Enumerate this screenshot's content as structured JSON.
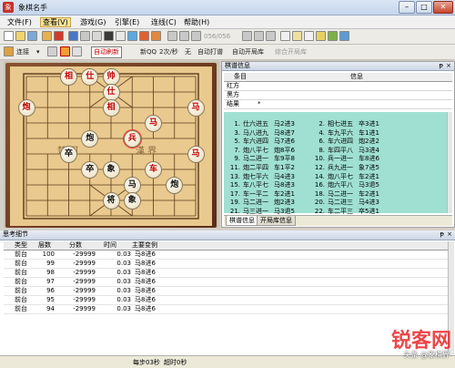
{
  "window": {
    "title": "象棋名手",
    "min": "–",
    "max": "□",
    "close": "✕"
  },
  "menu": [
    "文件(F)",
    "查看(V)",
    "游戏(G)",
    "引擎(E)",
    "连线(C)",
    "帮助(H)"
  ],
  "toolbar1": {
    "move_counter": "056/056"
  },
  "toolbar2": {
    "connect_label": "连接",
    "auto_refresh": "自动刷新",
    "new_qq": "新QQ",
    "rate": "2次/秒",
    "none": "无",
    "auto_play": "自动打谱",
    "auto_open": "自动开局库",
    "open_book": "综合开局库"
  },
  "board": {
    "pieces": [
      {
        "t": "相",
        "c": "red",
        "f": 3,
        "r": 1
      },
      {
        "t": "仕",
        "c": "red",
        "f": 4,
        "r": 1
      },
      {
        "t": "帅",
        "c": "red",
        "f": 5,
        "r": 1
      },
      {
        "t": "仕",
        "c": "red",
        "f": 5,
        "r": 2
      },
      {
        "t": "炮",
        "c": "red",
        "f": 1,
        "r": 3
      },
      {
        "t": "相",
        "c": "red",
        "f": 5,
        "r": 3
      },
      {
        "t": "马",
        "c": "red",
        "f": 9,
        "r": 3
      },
      {
        "t": "马",
        "c": "red",
        "f": 7,
        "r": 4
      },
      {
        "t": "炮",
        "c": "black",
        "f": 4,
        "r": 5
      },
      {
        "t": "兵",
        "c": "red",
        "f": 6,
        "r": 5
      },
      {
        "t": "卒",
        "c": "black",
        "f": 3,
        "r": 6
      },
      {
        "t": "马",
        "c": "red",
        "f": 9,
        "r": 6
      },
      {
        "t": "卒",
        "c": "black",
        "f": 4,
        "r": 7
      },
      {
        "t": "象",
        "c": "black",
        "f": 5,
        "r": 7
      },
      {
        "t": "车",
        "c": "red",
        "f": 7,
        "r": 7
      },
      {
        "t": "马",
        "c": "black",
        "f": 6,
        "r": 8
      },
      {
        "t": "炮",
        "c": "black",
        "f": 8,
        "r": 8
      },
      {
        "t": "将",
        "c": "black",
        "f": 5,
        "r": 9
      },
      {
        "t": "象",
        "c": "black",
        "f": 6,
        "r": 9
      }
    ]
  },
  "info_panel": {
    "title": "棋谱信息",
    "pin": "ᵽ",
    "close": "×",
    "col_item": "条目",
    "col_info": "信息",
    "rows": [
      {
        "item": "红方",
        "info": ""
      },
      {
        "item": "黑方",
        "info": ""
      },
      {
        "item": "结果",
        "info": "*"
      }
    ]
  },
  "moves": [
    {
      "n": "1.",
      "a": "仕六进五",
      "b": "马2进3",
      "c": "2.",
      "d": "相七进五",
      "e": "卒3进1"
    },
    {
      "n": "3.",
      "a": "马八进九",
      "b": "马8进7",
      "c": "4.",
      "d": "车九平六",
      "e": "车1进1"
    },
    {
      "n": "5.",
      "a": "车六进四",
      "b": "马7进6",
      "c": "6.",
      "d": "车六进四",
      "e": "炮2进2"
    },
    {
      "n": "7.",
      "a": "炮八平七",
      "b": "炮8平6",
      "c": "8.",
      "d": "车四平八",
      "e": "马3进4"
    },
    {
      "n": "9.",
      "a": "马二进一",
      "b": "车9平8",
      "c": "10.",
      "d": "兵一进一",
      "e": "车8进6"
    },
    {
      "n": "11.",
      "a": "炮二平四",
      "b": "车1平2",
      "c": "12.",
      "d": "兵九进一",
      "e": "象7进5"
    },
    {
      "n": "13.",
      "a": "炮七平六",
      "b": "马4进3",
      "c": "14.",
      "d": "炮八平七",
      "e": "车2进1"
    },
    {
      "n": "15.",
      "a": "车八平七",
      "b": "马8进3",
      "c": "16.",
      "d": "炮六平八",
      "e": "马3退5"
    },
    {
      "n": "17.",
      "a": "车一平二",
      "b": "车2进1",
      "c": "18.",
      "d": "马二进一",
      "e": "车2进1"
    },
    {
      "n": "19.",
      "a": "马二进一",
      "b": "炮2进3",
      "c": "20.",
      "d": "马二进三",
      "e": "马4进3"
    },
    {
      "n": "21.",
      "a": "马三进一",
      "b": "马3退5",
      "c": "22.",
      "d": "车二平三",
      "e": "卒5进1"
    }
  ],
  "bottom_tabs": [
    "棋谱信息",
    "开局库信息"
  ],
  "think_panel": {
    "title": "思考细节",
    "pin": "ᵽ",
    "close": "×",
    "headers": [
      "类型",
      "层数",
      "分数",
      "时间",
      "主要变例"
    ],
    "rows": [
      {
        "type": "前台",
        "depth": "100",
        "score": "-29999",
        "time": "0.03",
        "pv": "马8进6"
      },
      {
        "type": "前台",
        "depth": "99",
        "score": "-29999",
        "time": "0.03",
        "pv": "马8进6"
      },
      {
        "type": "前台",
        "depth": "98",
        "score": "-29999",
        "time": "0.03",
        "pv": "马8进6"
      },
      {
        "type": "前台",
        "depth": "97",
        "score": "-29999",
        "time": "0.03",
        "pv": "马8进6"
      },
      {
        "type": "前台",
        "depth": "96",
        "score": "-29999",
        "time": "0.03",
        "pv": "马8进6"
      },
      {
        "type": "前台",
        "depth": "95",
        "score": "-29999",
        "time": "0.03",
        "pv": "马8进6"
      },
      {
        "type": "前台",
        "depth": "94",
        "score": "-29999",
        "time": "0.03",
        "pv": "马8进6"
      }
    ]
  },
  "status": {
    "per_step": "每步03秒",
    "timeout": "超时0秒"
  },
  "watermark": {
    "main": "锐客网",
    "sub": "头条 @象棋界"
  },
  "colors": {
    "moves_bg": "#9fe0d2",
    "red_piece": "#c20000",
    "board_wood": "#6a3a1e"
  }
}
